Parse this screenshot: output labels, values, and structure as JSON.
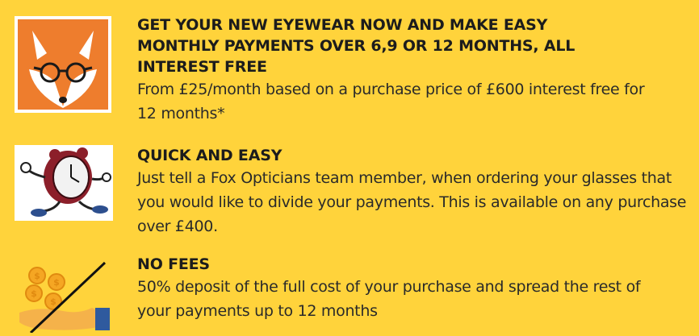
{
  "items": [
    {
      "heading": "GET YOUR NEW EYEWEAR NOW AND MAKE EASY MONTHLY PAYMENTS OVER 6,9 OR 12 MONTHS, ALL INTEREST FREE",
      "body": "From £25/month based on a purchase price of £600 interest free for 12 months*",
      "icon": "fox-glasses-icon"
    },
    {
      "heading": "QUICK AND EASY",
      "body": "Just tell a Fox Opticians team member, when ordering your glasses that you would like to divide your payments. This is available on any purchase over £400.",
      "icon": "running-clock-icon"
    },
    {
      "heading": "NO FEES",
      "body": "50% deposit of the full cost of your purchase and spread the rest of your payments up to 12 months",
      "icon": "no-fee-coins-icon"
    }
  ],
  "colors": {
    "background": "#ffd33b",
    "fox_orange": "#ee7d2d",
    "coin": "#f5a623",
    "cuff": "#2f5a9e"
  }
}
